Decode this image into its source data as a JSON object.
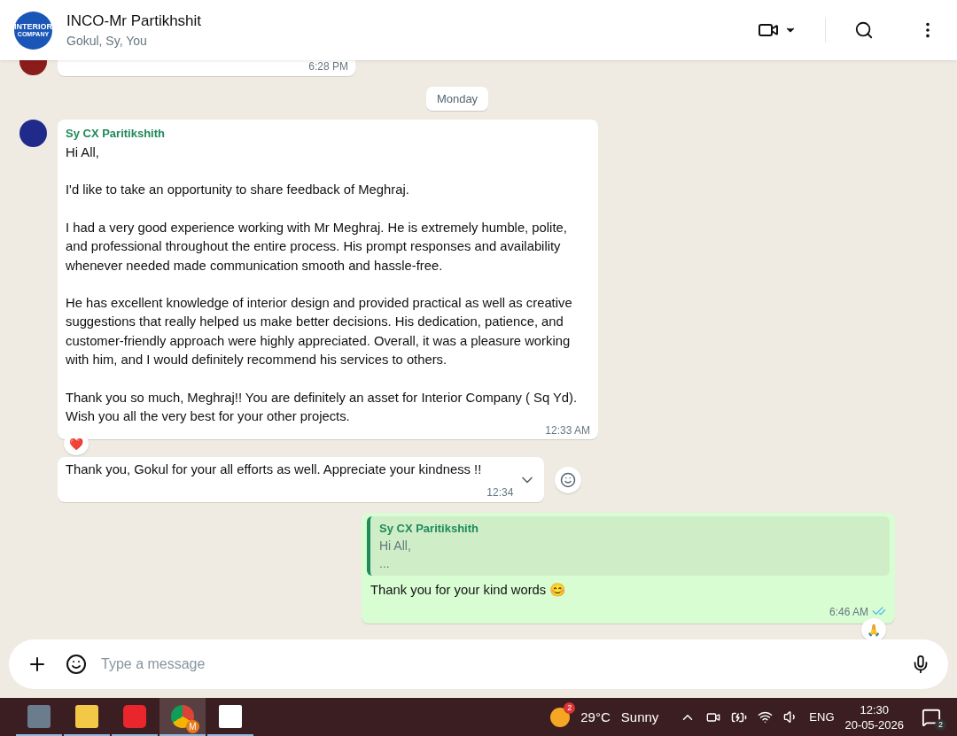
{
  "header": {
    "logo_text": [
      "INTERIOR",
      "COMPANY"
    ],
    "title": "INCO-Mr Partikhshit",
    "subtitle": "Gokul, Sy, You"
  },
  "earlier_message": {
    "time": "6:28 PM"
  },
  "date_chip": "Monday",
  "messages": [
    {
      "kind": "incoming",
      "sender": "Sy CX Paritikshith",
      "paragraphs": [
        "Hi All,",
        "I'd like to take an opportunity to share feedback of Meghraj.",
        "I had a very good experience working with Mr Meghraj. He is extremely humble, polite, and professional throughout the entire process. His prompt responses and availability whenever needed made communication smooth and hassle-free.",
        "He has excellent knowledge of interior design and provided practical as well as creative suggestions that really helped us make better decisions. His dedication, patience, and customer-friendly approach were highly appreciated. Overall, it was a pleasure working with him, and I would definitely recommend his services to others.",
        "Thank you so much, Meghraj!! You are definitely an asset for Interior Company ( Sq Yd). Wish you all the very best for your other projects."
      ],
      "time": "12:33 AM",
      "reaction": "❤️"
    },
    {
      "kind": "incoming_short",
      "text": "Thank you, Gokul for your all efforts as well. Appreciate your kindness !!",
      "time": "12:34"
    },
    {
      "kind": "outgoing",
      "quote": {
        "sender": "Sy CX Paritikshith",
        "lines": [
          "Hi All,",
          "..."
        ]
      },
      "text": "Thank you for your kind words 😊",
      "time": "6:46 AM",
      "read": true,
      "reaction": "🙏"
    }
  ],
  "composer": {
    "placeholder": "Type a message"
  },
  "taskbar": {
    "apps": [
      {
        "kind": "calculator",
        "selected": false
      },
      {
        "kind": "folder",
        "selected": false
      },
      {
        "kind": "wps",
        "selected": false
      },
      {
        "kind": "chrome",
        "selected": true,
        "badge": "M"
      },
      {
        "kind": "sketchup",
        "selected": false
      }
    ],
    "weather": {
      "badge": "2",
      "temp": "29°C",
      "condition": "Sunny"
    },
    "language": "ENG",
    "time": "12:30",
    "date": "20-05-2026",
    "notifications": "2"
  }
}
